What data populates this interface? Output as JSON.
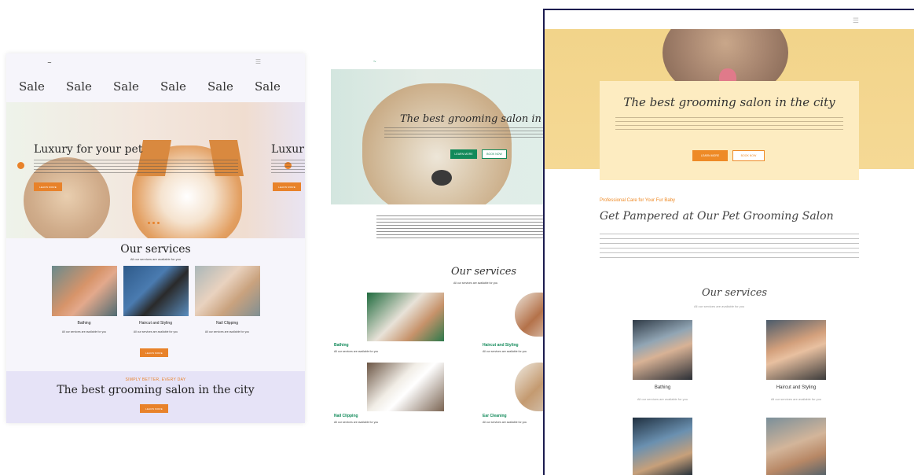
{
  "mockup1": {
    "logo": "~",
    "sale_strip": [
      "Sale",
      "Sale",
      "Sale",
      "Sale",
      "Sale",
      "Sale"
    ],
    "hero": {
      "title": "Luxury for your pet",
      "title_next": "Luxur",
      "button": "LEARN MORE"
    },
    "services": {
      "title": "Our services",
      "subtitle": "All our services are available for you",
      "items": [
        {
          "name": "Bathing",
          "desc": "All our services are available for you"
        },
        {
          "name": "Haircut and Styling",
          "desc": "All our services are available for you"
        },
        {
          "name": "Nail Clipping",
          "desc": "All our services are available for you"
        }
      ],
      "button": "LEARN MORE"
    },
    "promo": {
      "tag": "SIMPLY BETTER, EVERY DAY",
      "title": "The best grooming salon in the city",
      "button": "LEARN MORE"
    }
  },
  "mockup2": {
    "logo": "~",
    "hero": {
      "title": "The best grooming salon in the c",
      "button_primary": "LEARN MORE",
      "button_secondary": "BOOK NOW"
    },
    "services": {
      "title": "Our services",
      "subtitle": "All our services are available for you",
      "items": [
        {
          "name": "Bathing",
          "desc": "All our services are available for you"
        },
        {
          "name": "Haircut and Styling",
          "desc": "All our services are available for you"
        },
        {
          "name": "Nail Clipping",
          "desc": "All our services are available for you"
        },
        {
          "name": "Ear Cleaning",
          "desc": "All our services are available for you"
        }
      ]
    }
  },
  "mockup3": {
    "hero": {
      "title": "The best grooming salon in the city",
      "button_primary": "LEARN MORE",
      "button_secondary": "BOOK NOW"
    },
    "intro": {
      "eyebrow": "Professional Care for Your Fur Baby",
      "title": "Get Pampered at Our Pet Grooming Salon"
    },
    "services": {
      "title": "Our services",
      "subtitle": "All our services are available for you",
      "items": [
        {
          "name": "Bathing",
          "desc": "All our services are available for you"
        },
        {
          "name": "Haircut and Styling",
          "desc": "All our services are available for you"
        }
      ]
    }
  },
  "colors": {
    "orange": "#e8822a",
    "green": "#128a5a",
    "lavender": "#e6e3f7",
    "yellow": "#f2d48a",
    "navy": "#1b1b4f"
  },
  "icons": {
    "menu": "hamburger-icon",
    "slider_arrow": "arrow-icon"
  }
}
